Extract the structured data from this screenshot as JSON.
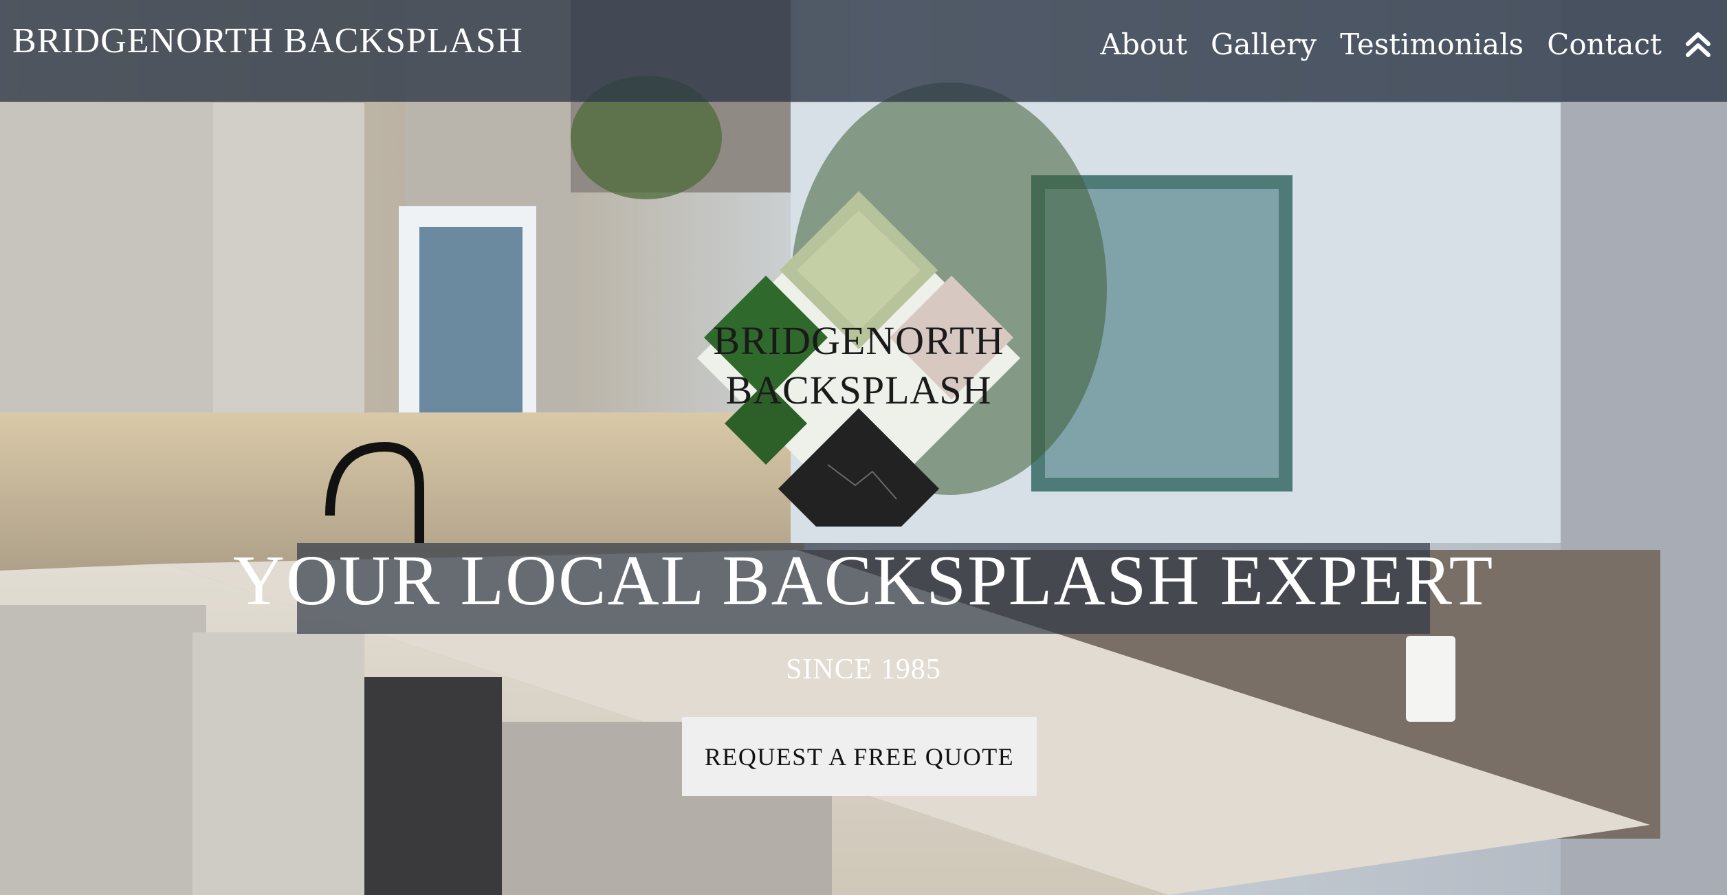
{
  "header": {
    "brand": "BRIDGENORTH BACKSPLASH",
    "nav": [
      {
        "label": "About"
      },
      {
        "label": "Gallery"
      },
      {
        "label": "Testimonials"
      },
      {
        "label": "Contact"
      }
    ],
    "back_to_top_icon": "double-chevron-up-icon"
  },
  "hero": {
    "logo": {
      "line1": "BRIDGENORTH",
      "line2": "BACKSPLASH"
    },
    "headline": "YOUR LOCAL BACKSPLASH EXPERT",
    "subline": "SINCE 1985",
    "cta_label": "REQUEST A FREE QUOTE"
  },
  "colors": {
    "nav_bg": "#2d3746",
    "cta_bg": "#efefef",
    "text_light": "#ffffff"
  }
}
